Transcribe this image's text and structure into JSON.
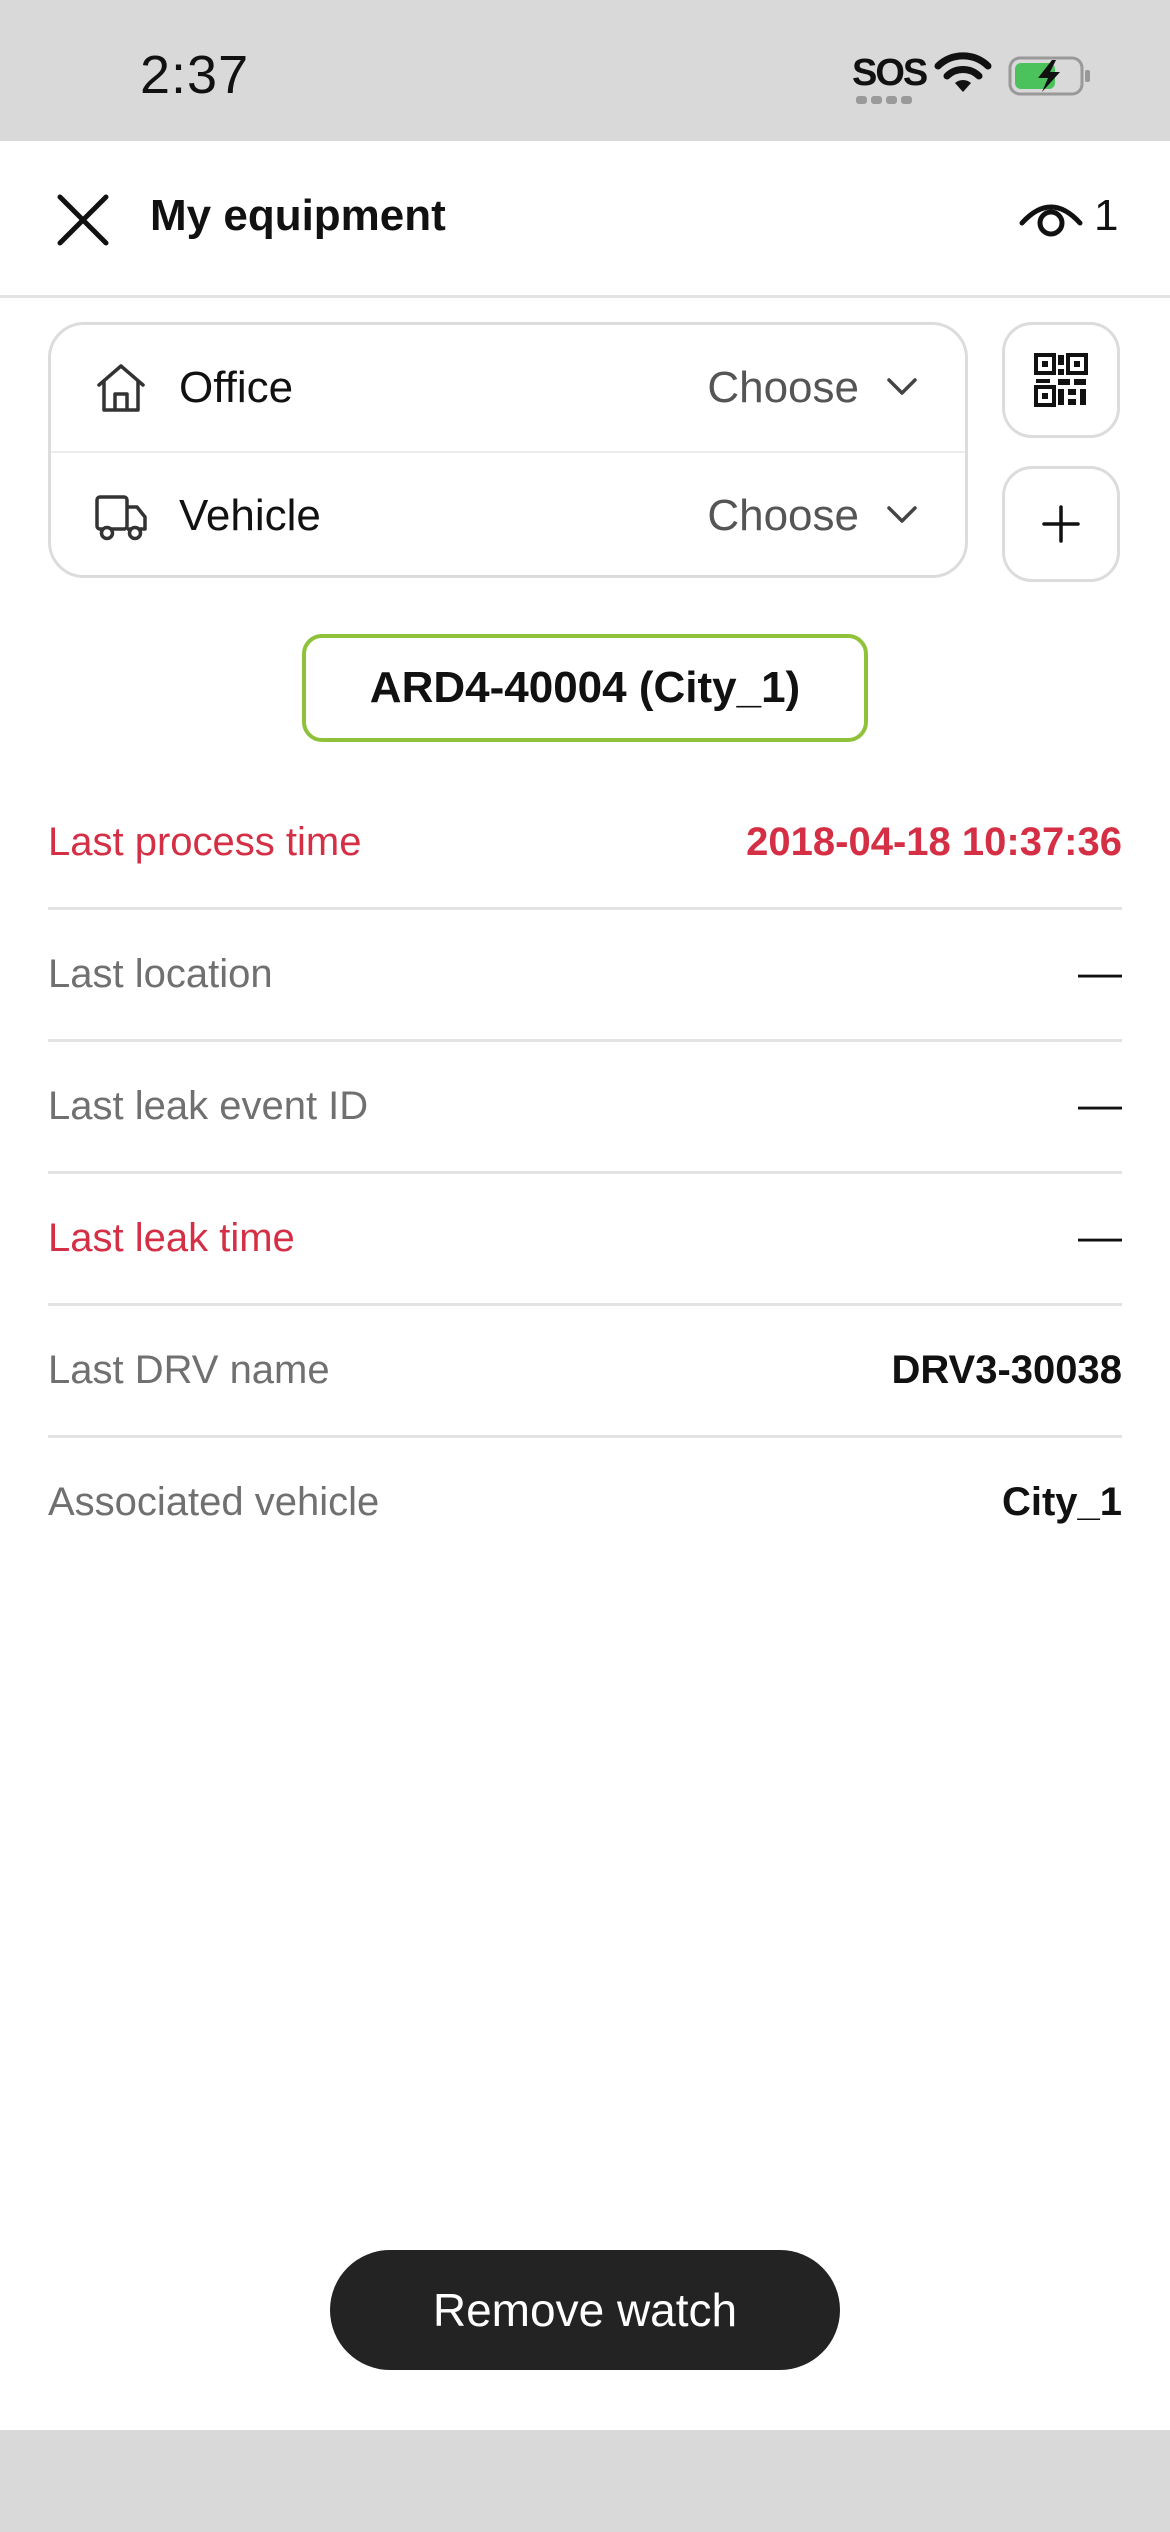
{
  "status_bar": {
    "time": "2:37",
    "sos": "SOS",
    "icons": [
      "wifi-icon",
      "battery-charging-icon"
    ]
  },
  "header": {
    "title": "My equipment",
    "watch_count": "1",
    "icons": [
      "close-icon",
      "eye-icon"
    ]
  },
  "selectors": [
    {
      "icon": "home-icon",
      "label": "Office",
      "value": "Choose"
    },
    {
      "icon": "truck-icon",
      "label": "Vehicle",
      "value": "Choose"
    }
  ],
  "side_buttons": [
    "qr-code-icon",
    "plus-icon"
  ],
  "device": {
    "label": "ARD4-40004 (City_1)",
    "border_color": "#8fc13a"
  },
  "info": [
    {
      "label": "Last process time",
      "value": "2018-04-18 10:37:36",
      "alert": true
    },
    {
      "label": "Last location",
      "value": "—",
      "alert": false
    },
    {
      "label": "Last leak event ID",
      "value": "—",
      "alert": false
    },
    {
      "label": "Last leak time",
      "value": "—",
      "alert": true
    },
    {
      "label": "Last DRV name",
      "value": "DRV3-30038",
      "alert": false
    },
    {
      "label": "Associated vehicle",
      "value": "City_1",
      "alert": false
    }
  ],
  "colors": {
    "alert": "#d42f45",
    "button_bg": "#232323"
  },
  "actions": {
    "remove_watch_label": "Remove watch"
  }
}
